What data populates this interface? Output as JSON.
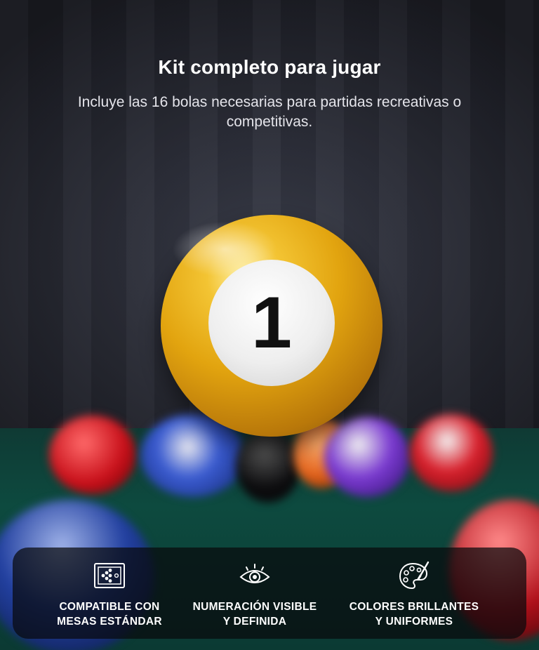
{
  "header": {
    "title": "Kit completo para jugar",
    "subtitle": "Incluye las 16 bolas necesarias para partidas recreativas o competitivas."
  },
  "hero_ball": {
    "number": "1",
    "color": "#e2a40f"
  },
  "features": [
    {
      "icon": "pool-table-icon",
      "label": "COMPATIBLE CON\nMESAS ESTÁNDAR"
    },
    {
      "icon": "eye-icon",
      "label": "NUMERACIÓN VISIBLE\nY DEFINIDA"
    },
    {
      "icon": "palette-icon",
      "label": "COLORES BRILLANTES\nY UNIFORMES"
    }
  ],
  "colors": {
    "text": "#ffffff",
    "felt": "#0d4a3f",
    "panel": "#080a0c"
  }
}
